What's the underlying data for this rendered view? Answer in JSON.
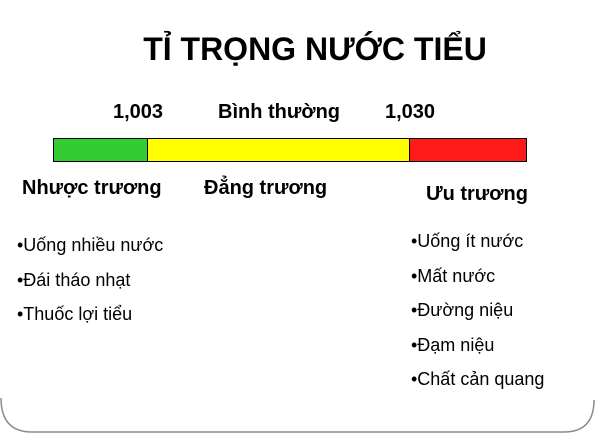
{
  "title": "TỈ TRỌNG NƯỚC TIỂU",
  "scale": {
    "low_value": "1,003",
    "normal_label": "Bình thường",
    "high_value": "1,030",
    "segments": [
      {
        "color": "#33CC33"
      },
      {
        "color": "#FFFF00"
      },
      {
        "color": "#FF1A1A"
      }
    ]
  },
  "categories": {
    "hypo": {
      "label": "Nhược trương",
      "items": [
        "•Uống nhiều nước",
        "•Đái tháo nhạt",
        "•Thuốc lợi tiểu"
      ]
    },
    "iso": {
      "label": "Đẳng trương"
    },
    "hyper": {
      "label": "Ưu trương",
      "items": [
        "•Uống ít nước",
        "•Mất nước",
        "•Đường niệu",
        "•Đạm niệu",
        "•Chất cản quang"
      ]
    }
  }
}
